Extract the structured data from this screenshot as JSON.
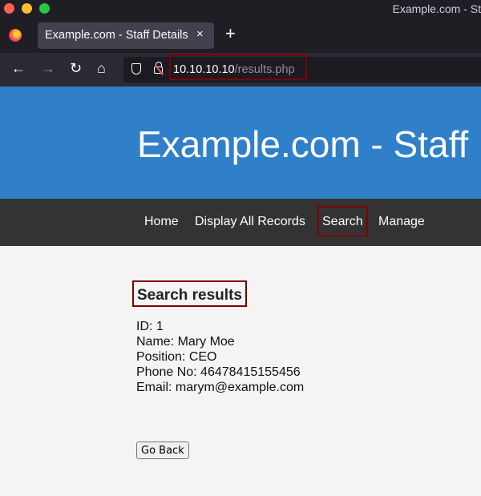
{
  "browser": {
    "window_title": "Example.com - St",
    "tab": {
      "label": "Example.com - Staff Details",
      "close": "×"
    },
    "new_tab": "+",
    "address": {
      "host": "10.10.10.10",
      "path": "/results.php"
    },
    "icons": [
      "back-icon",
      "forward-icon",
      "reload-icon",
      "home-icon",
      "shield-icon",
      "insecure-lock-icon"
    ]
  },
  "site": {
    "title": "Example.com - Staff Details",
    "nav": [
      "Home",
      "Display All Records",
      "Search",
      "Manage"
    ]
  },
  "results": {
    "heading": "Search results",
    "lines": [
      "ID: 1",
      "Name: Mary Moe",
      "Position: CEO",
      "Phone No: 46478415155456",
      "Email: marym@example.com"
    ],
    "button": "Go Back"
  },
  "colors": {
    "header": "#2f80c9",
    "nav": "#333333",
    "highlight_box": "#7f0000",
    "background": "#f4f4f4"
  }
}
